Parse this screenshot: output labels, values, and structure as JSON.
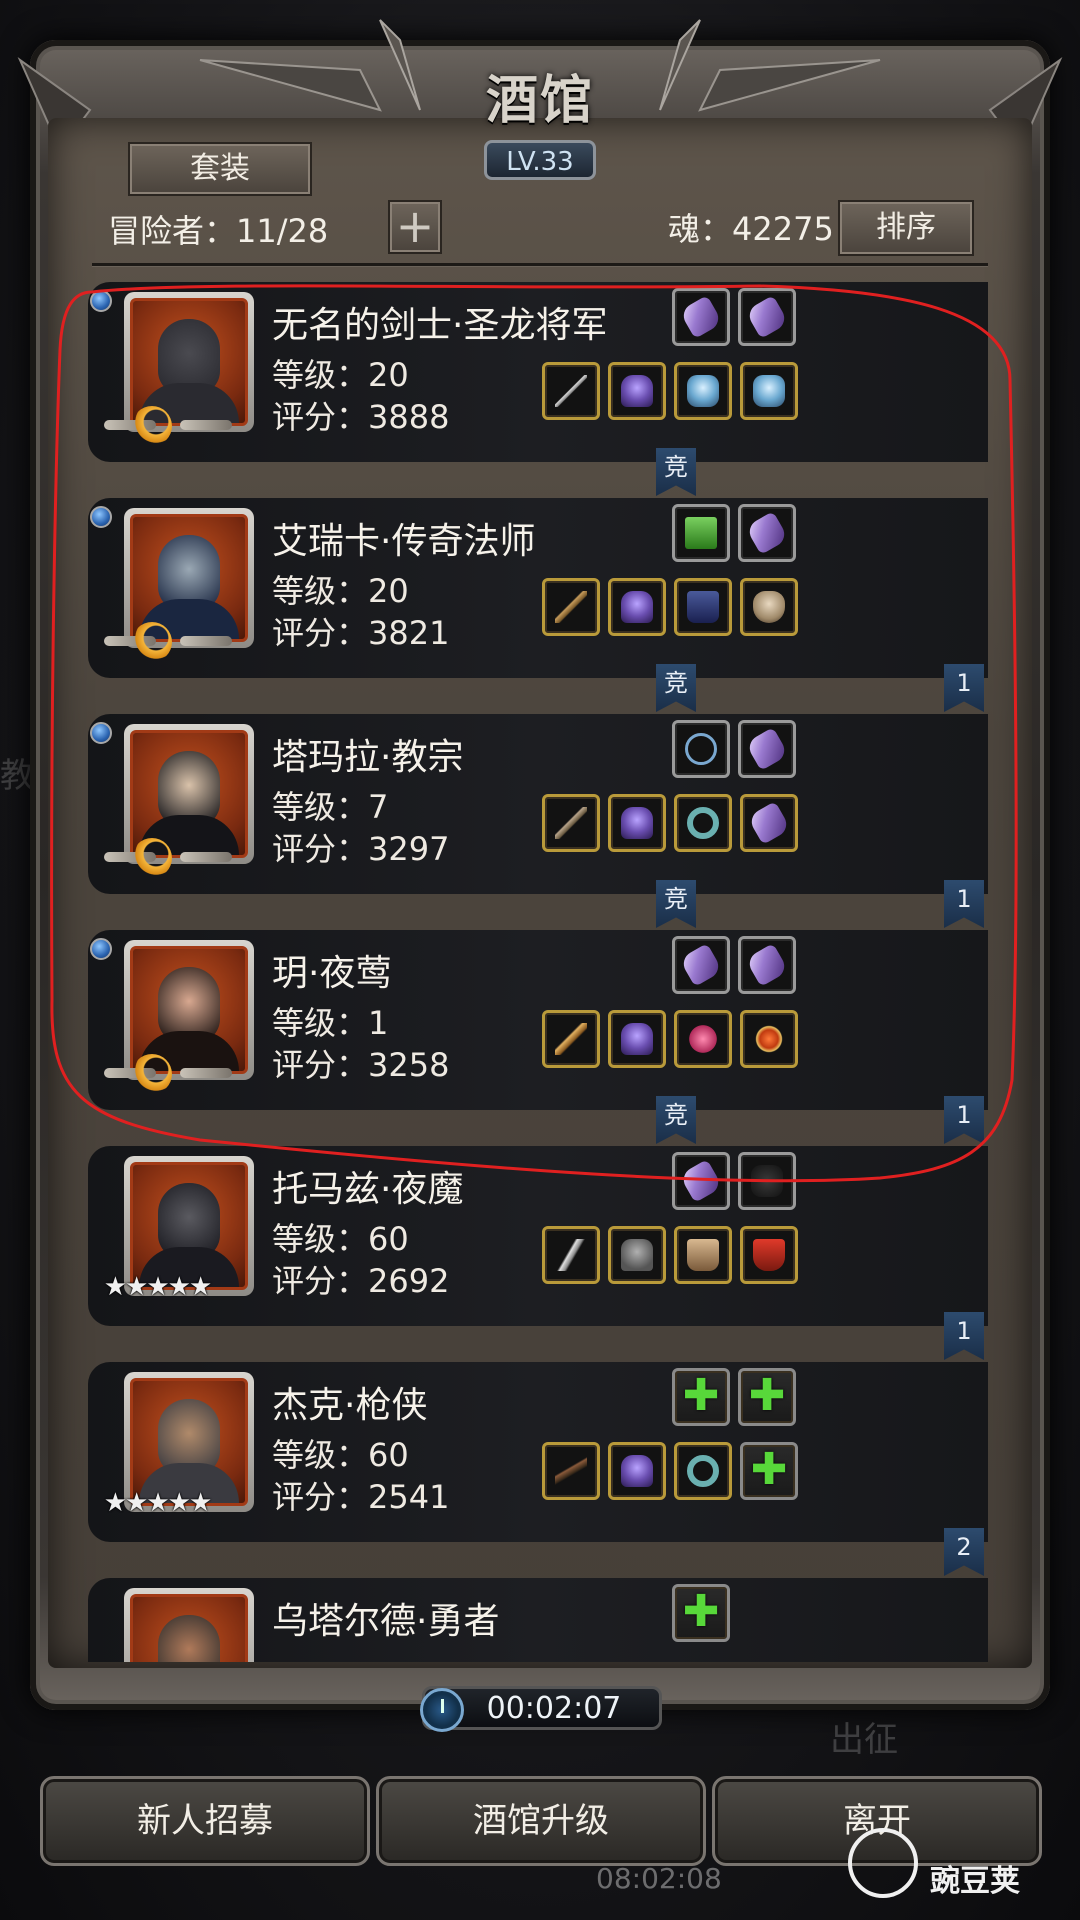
{
  "header": {
    "title": "酒馆",
    "level": "LV.33",
    "suit_button": "套装",
    "adventurers": "冒险者：11/28",
    "plus_symbol": "+",
    "soul": "魂：42275",
    "sort_button": "排序"
  },
  "background_hints": {
    "left_char": "教",
    "right_text": "出征"
  },
  "heroes": [
    {
      "name": "无名的剑士·圣龙将军",
      "level": "等级：20",
      "score": "评分：3888",
      "badge": "moon",
      "portrait": "knight-helmet",
      "top_slots": [
        "crystal",
        "crystal"
      ],
      "bottom_slots": [
        "sword",
        "armor",
        "blue-gauntlet",
        "blue-gauntlet"
      ],
      "tags": [
        "竞"
      ]
    },
    {
      "name": "艾瑞卡·传奇法师",
      "level": "等级：20",
      "score": "评分：3821",
      "badge": "moon",
      "portrait": "hooded-mage",
      "top_slots": [
        "green-book",
        "crystal"
      ],
      "bottom_slots": [
        "staff",
        "armor",
        "boots",
        "mask"
      ],
      "tags": [
        "竞",
        "1"
      ]
    },
    {
      "name": "塔玛拉·教宗",
      "level": "等级：7",
      "score": "评分：3297",
      "badge": "moon",
      "portrait": "nun",
      "top_slots": [
        "necklace",
        "crystal"
      ],
      "bottom_slots": [
        "hammer",
        "armor",
        "ring",
        "crystal"
      ],
      "tags": [
        "竞",
        "1"
      ]
    },
    {
      "name": "玥·夜莺",
      "level": "等级：1",
      "score": "评分：3258",
      "badge": "moon",
      "portrait": "hat-girl",
      "top_slots": [
        "crystal",
        "crystal"
      ],
      "bottom_slots": [
        "dagger",
        "armor",
        "pendant",
        "orb"
      ],
      "tags": [
        "竞",
        "1"
      ]
    },
    {
      "name": "托马兹·夜魔",
      "level": "等级：60",
      "score": "评分：2692",
      "badge": "stars",
      "stars": "★★★★★",
      "portrait": "masked-rogue",
      "top_slots": [
        "crystal",
        "glove"
      ],
      "bottom_slots": [
        "curved-blade",
        "vest",
        "boots2",
        "cape"
      ],
      "tags": [
        "1"
      ]
    },
    {
      "name": "杰克·枪侠",
      "level": "等级：60",
      "score": "评分：2541",
      "badge": "stars",
      "stars": "★★★★★",
      "portrait": "gunslinger",
      "top_slots": [
        "empty",
        "empty"
      ],
      "bottom_slots": [
        "rifle",
        "armor",
        "ring",
        "empty"
      ],
      "tags": [
        "2"
      ]
    },
    {
      "name": "乌塔尔德·勇者",
      "level": "",
      "score": "",
      "badge": "none",
      "portrait": "brave",
      "top_slots": [
        "empty"
      ],
      "bottom_slots": [],
      "tags": []
    }
  ],
  "timer": "00:02:07",
  "bottom_buttons": {
    "recruit": "新人招募",
    "upgrade": "酒馆升级",
    "leave": "离开"
  },
  "bottom_time": "08:02:08",
  "watermark": "豌豆荚",
  "colors": {
    "gold_border": "#b99a3a",
    "tag_blue": "#2d4b6e",
    "portrait_orange": "#c2501e",
    "highlight_red": "#e02020"
  }
}
